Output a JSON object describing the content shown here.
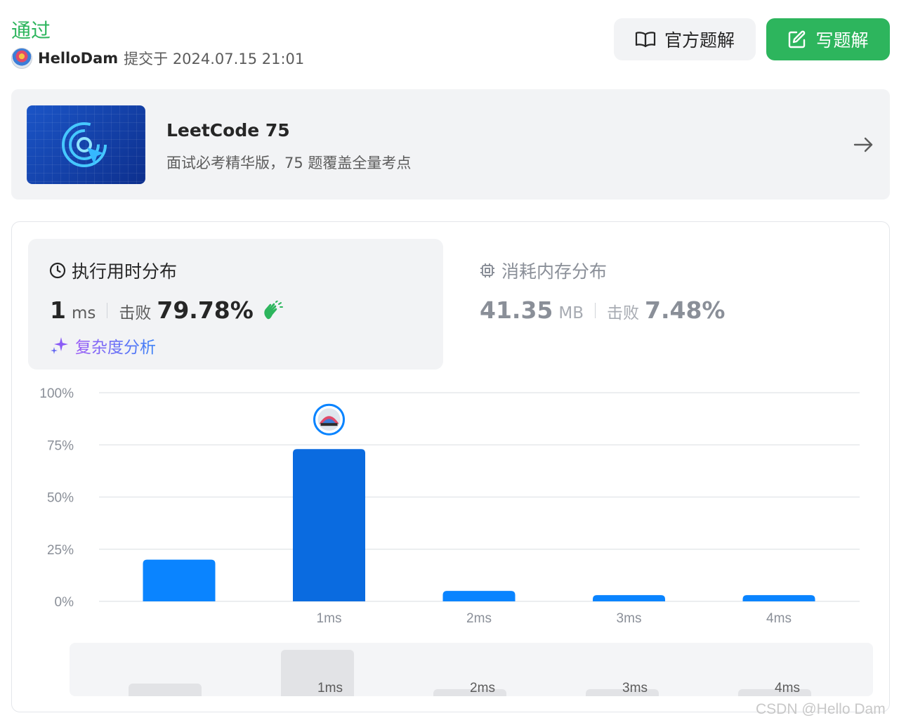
{
  "header": {
    "status": "通过",
    "username": "HelloDam",
    "submit_meta": "提交于 2024.07.15 21:01",
    "official_solution_label": "官方题解",
    "write_solution_label": "写题解"
  },
  "banner": {
    "title": "LeetCode 75",
    "subtitle": "面试必考精华版，75 题覆盖全量考点",
    "icon": "target-cursor-icon"
  },
  "runtime": {
    "title": "执行用时分布",
    "value": "1",
    "unit": "ms",
    "beat_label": "击败",
    "beat_value": "79.78%",
    "complexity_label": "复杂度分析",
    "icon": "clock-icon"
  },
  "memory": {
    "title": "消耗内存分布",
    "value": "41.35",
    "unit": "MB",
    "beat_label": "击败",
    "beat_value": "7.48%",
    "icon": "chip-icon"
  },
  "colors": {
    "accent_green": "#2db55d",
    "bar_blue": "#0a84ff",
    "bar_selected": "#0a6be0",
    "grid": "#e6e8eb"
  },
  "chart_data": {
    "type": "bar",
    "categories": [
      "",
      "1ms",
      "2ms",
      "3ms",
      "4ms"
    ],
    "values": [
      20,
      73,
      5,
      3,
      3
    ],
    "highlight_index": 1,
    "yticks": [
      "100%",
      "75%",
      "50%",
      "25%",
      "0%"
    ],
    "ylim": [
      0,
      100
    ],
    "grid": true
  },
  "minimap": {
    "labels": [
      "",
      "1ms",
      "2ms",
      "3ms",
      "4ms"
    ],
    "values": [
      20,
      73,
      5,
      3,
      3
    ]
  },
  "watermark": "CSDN @Hello Dam"
}
